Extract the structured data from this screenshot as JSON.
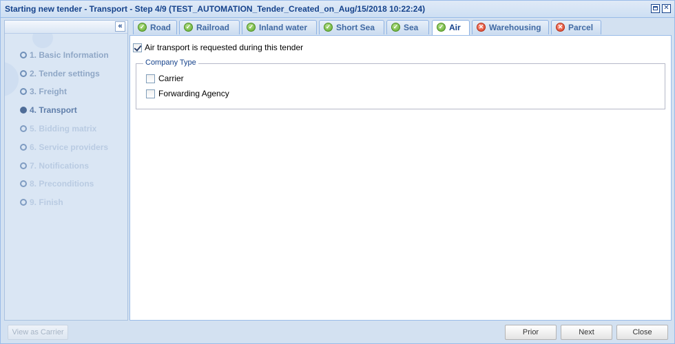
{
  "window": {
    "title": "Starting new tender - Transport - Step 4/9 (TEST_AUTOMATION_Tender_Created_on_Aug/15/2018 10:22:24)",
    "maximize_icon": "maximize-icon",
    "close_icon": "close-icon",
    "close_glyph": "✕"
  },
  "sidebar": {
    "collapse_glyph": "«",
    "steps": [
      {
        "label": "1. Basic Information",
        "state": "done"
      },
      {
        "label": "2. Tender settings",
        "state": "done"
      },
      {
        "label": "3. Freight",
        "state": "done"
      },
      {
        "label": "4. Transport",
        "state": "current"
      },
      {
        "label": "5. Bidding matrix",
        "state": "future"
      },
      {
        "label": "6. Service providers",
        "state": "future"
      },
      {
        "label": "7. Notifications",
        "state": "future"
      },
      {
        "label": "8. Preconditions",
        "state": "future"
      },
      {
        "label": "9. Finish",
        "state": "future"
      }
    ]
  },
  "tabs": [
    {
      "label": "Road",
      "status": "ok",
      "active": false
    },
    {
      "label": "Railroad",
      "status": "ok",
      "active": false
    },
    {
      "label": "Inland water",
      "status": "ok",
      "active": false
    },
    {
      "label": "Short Sea",
      "status": "ok",
      "active": false
    },
    {
      "label": "Sea",
      "status": "ok",
      "active": false
    },
    {
      "label": "Air",
      "status": "ok",
      "active": true
    },
    {
      "label": "Warehousing",
      "status": "error",
      "active": false
    },
    {
      "label": "Parcel",
      "status": "error",
      "active": false
    }
  ],
  "content": {
    "air_requested_label": "Air transport is requested during this tender",
    "air_requested_checked": true,
    "company_type": {
      "legend": "Company Type",
      "options": [
        {
          "label": "Carrier",
          "checked": false
        },
        {
          "label": "Forwarding Agency",
          "checked": false
        }
      ]
    }
  },
  "footer": {
    "view_as_carrier": "View as Carrier",
    "prior": "Prior",
    "next": "Next",
    "close": "Close"
  },
  "colors": {
    "title_text": "#15428b",
    "ok_icon": "#5da92b",
    "error_icon": "#d5391f"
  }
}
